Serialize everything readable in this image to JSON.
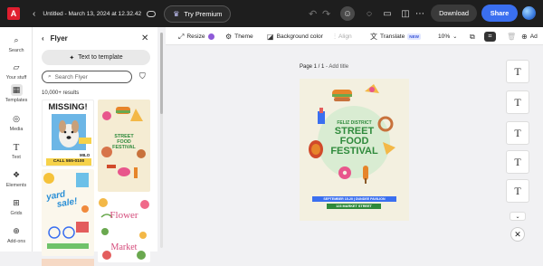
{
  "app": {
    "document_title": "Untitled - March 13, 2024 at 12.32.42"
  },
  "top_bar": {
    "premium_label": "Try Premium",
    "download_label": "Download",
    "share_label": "Share"
  },
  "rail": {
    "items": [
      {
        "label": "Search",
        "icon": "search-icon"
      },
      {
        "label": "Your stuff",
        "icon": "folder-icon"
      },
      {
        "label": "Templates",
        "icon": "templates-icon"
      },
      {
        "label": "Media",
        "icon": "media-icon"
      },
      {
        "label": "Text",
        "icon": "text-icon"
      },
      {
        "label": "Elements",
        "icon": "elements-icon"
      },
      {
        "label": "Grids",
        "icon": "grids-icon"
      },
      {
        "label": "Add-ons",
        "icon": "add-ons-icon"
      }
    ]
  },
  "panel": {
    "title": "Flyer",
    "text_to_template_label": "Text to template",
    "search_placeholder": "Search Flyer",
    "results_count": "10,000+ results",
    "thumbnails": {
      "missing": {
        "heading": "MISSING!",
        "tag": "MILO",
        "footer": "CALL 555-0100"
      },
      "street_food": {
        "line1": "STREET",
        "line2": "FOOD",
        "line3": "FESTIVAL"
      },
      "yard_sale": {
        "line1": "yard",
        "line2": "sale!"
      },
      "flower_market": {
        "line1": "Flower",
        "line2": "Market"
      }
    }
  },
  "secondary_toolbar": {
    "resize_label": "Resize",
    "theme_label": "Theme",
    "background_color_label": "Background color",
    "align_label": "Align",
    "translate_label": "Translate",
    "new_badge": "NEW",
    "zoom": "10%",
    "truncated_label": "Ad"
  },
  "page": {
    "label": "Page 1 / 1",
    "add_title": "Add title"
  },
  "flyer": {
    "kicker": "FELIZ DISTRICT",
    "line1": "STREET",
    "line2": "FOOD",
    "line3": "FESTIVAL",
    "date_line": "SEPTEMBER 15-20 | DUNDEE PAVILION",
    "address": "123 MARKET STREET"
  },
  "right_tools": {
    "glyph": "T"
  },
  "colors": {
    "accent": "#3a6ff0",
    "topbar": "#1e1e1e",
    "flyer_green": "#2f8a3c"
  }
}
